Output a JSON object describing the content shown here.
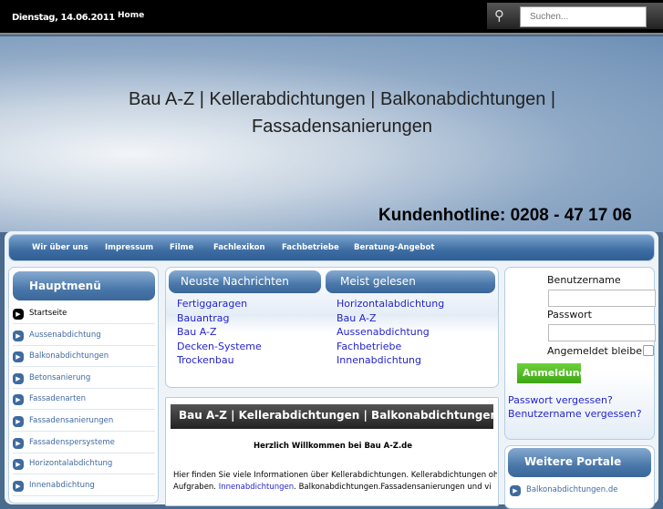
{
  "topbar": {
    "date": "Dienstag, 14.06.2011",
    "home": "Home",
    "search_placeholder": "Suchen...",
    "search_icon": "magnifier-icon"
  },
  "header": {
    "title": "Bau A-Z | Kellerabdichtungen | Balkonabdichtungen | Fassadensanierungen",
    "hotline": "Kundenhotline: 0208 - 47 17 06"
  },
  "nav": [
    "Wir über uns",
    "Impressum",
    "Filme",
    "Fachlexikon",
    "Fachbetriebe",
    "Beratung-Angebot"
  ],
  "mainmenu": {
    "title": "Hauptmenü",
    "items": [
      "Startseite",
      "Aussenabdichtung",
      "Balkonabdichtungen",
      "Betonsanierung",
      "Fassadenarten",
      "Fassadensanierungen",
      "Fassadenspersysteme",
      "Horizontalabdichtung",
      "Innenabdichtung"
    ]
  },
  "news": {
    "title": "Neuste Nachrichten",
    "items": [
      "Fertiggaragen",
      "Bauantrag",
      "Bau A-Z",
      "Decken-Systeme",
      "Trockenbau"
    ]
  },
  "popular": {
    "title": "Meist gelesen",
    "items": [
      "Horizontalabdichtung",
      "Bau A-Z",
      "Aussenabdichtung",
      "Fachbetriebe",
      "Innenabdichtung"
    ]
  },
  "article": {
    "title": "Bau A-Z | Kellerabdichtungen | Balkonabdichtungen |",
    "welcome": "Herzlich Willkommen bei Bau A-Z.de",
    "line1": "Hier finden Sie viele Informationen über Kellerabdichtungen. Kellerabdichtungen oh",
    "line2_pre": "Aufgraben. ",
    "line2_link": "Innenabdichtungen",
    "line2_post": ". Balkonabdichtungen.Fassadensanierungen und vi"
  },
  "login": {
    "username_label": "Benutzername",
    "password_label": "Passwort",
    "remember_label": "Angemeldet bleiben",
    "submit": "Anmeldung",
    "forgot_password": "Passwort vergessen?",
    "forgot_username": "Benutzername vergessen?"
  },
  "portals": {
    "title": "Weitere Portale",
    "items": [
      "Balkonabdichtungen.de"
    ]
  }
}
